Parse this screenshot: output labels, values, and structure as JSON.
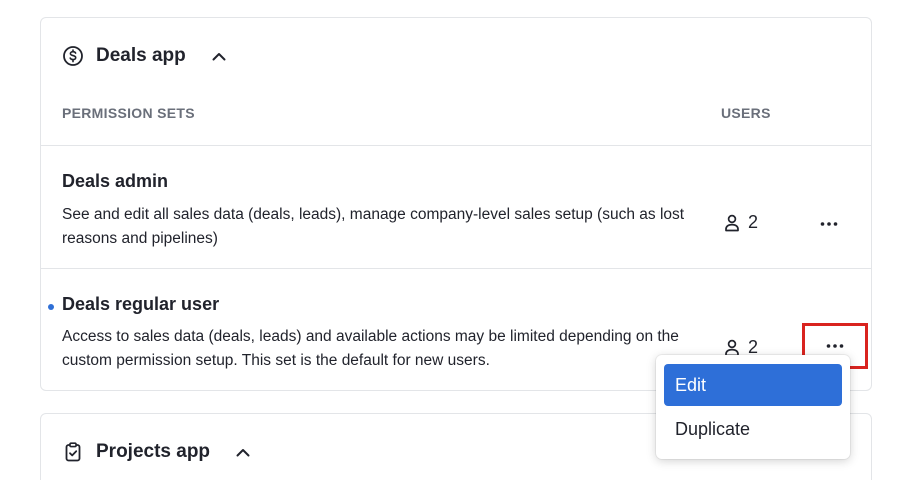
{
  "deals_section": {
    "title": "Deals app",
    "icon": "dollar-circle-icon",
    "columns": {
      "permission_sets": "PERMISSION SETS",
      "users": "USERS"
    },
    "rows": [
      {
        "title": "Deals admin",
        "description": "See and edit all sales data (deals, leads), manage company-level sales setup (such as lost reasons and pipelines)",
        "users": "2"
      },
      {
        "title": "Deals regular user",
        "description": "Access to sales data (deals, leads) and available actions may be limited depending on the custom permission setup. This set is the default for new users.",
        "users": "2"
      }
    ]
  },
  "projects_section": {
    "title": "Projects app",
    "icon": "clipboard-check-icon"
  },
  "context_menu": {
    "items": [
      {
        "label": "Edit",
        "active": true
      },
      {
        "label": "Duplicate",
        "active": false
      }
    ]
  },
  "colors": {
    "accent": "#2e6fd8",
    "highlight_border": "#d9231f",
    "text": "#21232c",
    "muted": "#6a6f7a"
  }
}
